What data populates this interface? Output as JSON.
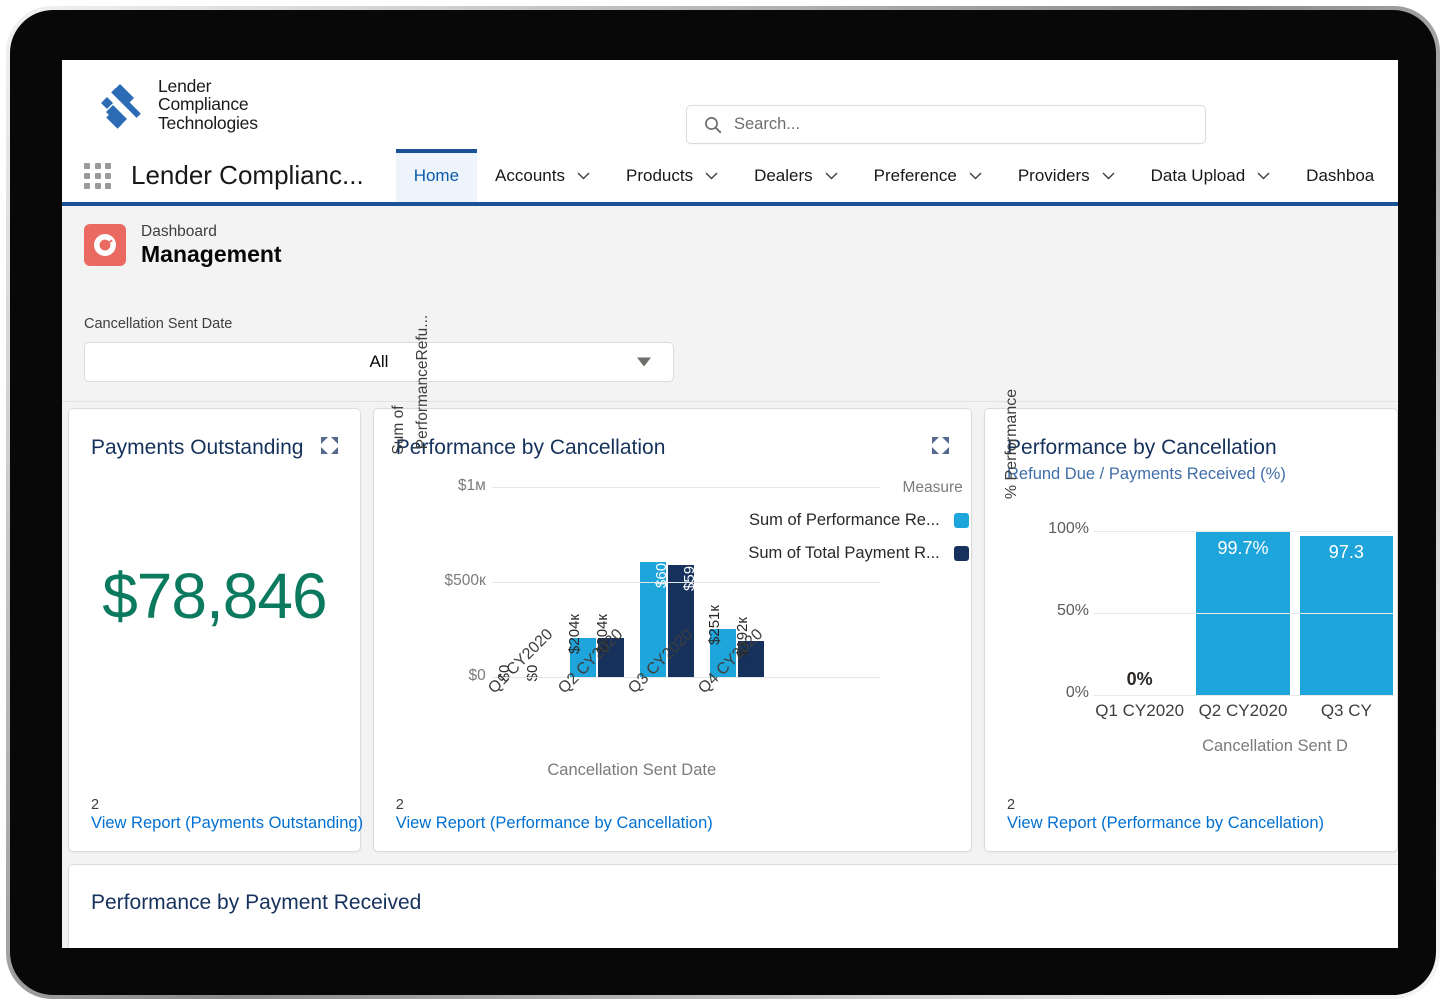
{
  "brand": {
    "logo_line1": "Lender",
    "logo_line2": "Compliance",
    "logo_line3": "Technologies",
    "logo_color": "#2c6cb5"
  },
  "search": {
    "placeholder": "Search...",
    "icon": "search-icon"
  },
  "appnav": {
    "app_name": "Lender Complianc...",
    "waffle_icon": "app-launcher-icon",
    "tabs": [
      {
        "label": "Home",
        "active": true,
        "has_menu": false
      },
      {
        "label": "Accounts",
        "active": false,
        "has_menu": true
      },
      {
        "label": "Products",
        "active": false,
        "has_menu": true
      },
      {
        "label": "Dealers",
        "active": false,
        "has_menu": true
      },
      {
        "label": "Preference",
        "active": false,
        "has_menu": true
      },
      {
        "label": "Providers",
        "active": false,
        "has_menu": true
      },
      {
        "label": "Data Upload",
        "active": false,
        "has_menu": true
      },
      {
        "label": "Dashboa",
        "active": false,
        "has_menu": false
      }
    ]
  },
  "dashboard_header": {
    "eyebrow": "Dashboard",
    "title": "Management",
    "icon": "dashboard-gauge-icon",
    "icon_color": "#ea6a62",
    "filter_label": "Cancellation Sent Date",
    "filter_value": "All"
  },
  "cards": {
    "payments_outstanding": {
      "title": "Payments Outstanding",
      "value": "$78,846",
      "value_color": "#0c7a5e",
      "footer_count": "2",
      "footer_link": "View Report (Payments Outstanding)"
    },
    "performance_by_cancellation_amount": {
      "title": "Performance by Cancellation",
      "footer_count": "2",
      "footer_link": "View Report (Performance by Cancellation)"
    },
    "performance_by_cancellation_pct": {
      "title": "Performance by Cancellation",
      "subtitle": "Refund Due / Payments Received (%)",
      "footer_count": "2",
      "footer_link": "View Report (Performance by Cancellation)"
    }
  },
  "bottom_panel": {
    "title": "Performance by Payment Received"
  },
  "chart_data": [
    {
      "type": "bar",
      "title": "Performance by Cancellation",
      "xlabel": "Cancellation Sent Date",
      "ylabel": "Sum of PerformanceRefu...",
      "ylabel_line1": "Sum of",
      "ylabel_line2": "PerformanceRefu...",
      "categories": [
        "Q1 CY2020",
        "Q2 CY2020",
        "Q3 CY2020",
        "Q4 CY2020"
      ],
      "ylim": [
        0,
        1000000
      ],
      "yticks": [
        0,
        500000,
        1000000
      ],
      "ytick_labels": [
        "$0",
        "$500к",
        "$1м"
      ],
      "grid": true,
      "legend_title": "Measure",
      "legend_position": "right",
      "series": [
        {
          "name": "Sum of Performance Re...",
          "color": "#1ea5dc",
          "values": [
            0,
            204000,
            607000,
            251000
          ],
          "labels": [
            "$0",
            "$204к",
            "$607к",
            "$251к"
          ]
        },
        {
          "name": "Sum of Total Payment R...",
          "color": "#16325c",
          "values": [
            0,
            204000,
            591000,
            192000
          ],
          "labels": [
            "$0",
            "$204к",
            "$591к",
            "$192к"
          ]
        }
      ]
    },
    {
      "type": "bar",
      "title": "Performance by Cancellation",
      "subtitle": "Refund Due / Payments Received (%)",
      "xlabel": "Cancellation Sent D",
      "ylabel": "% Performance",
      "categories": [
        "Q1 CY2020",
        "Q2 CY2020",
        "Q3 CY"
      ],
      "ylim": [
        0,
        110
      ],
      "yticks": [
        0,
        50,
        100
      ],
      "ytick_labels": [
        "0%",
        "50%",
        "100%"
      ],
      "grid": true,
      "bar_color": "#1ea5dc",
      "values": [
        0,
        99.7,
        97.3
      ],
      "labels": [
        "0%",
        "99.7%",
        "97.3"
      ]
    }
  ]
}
